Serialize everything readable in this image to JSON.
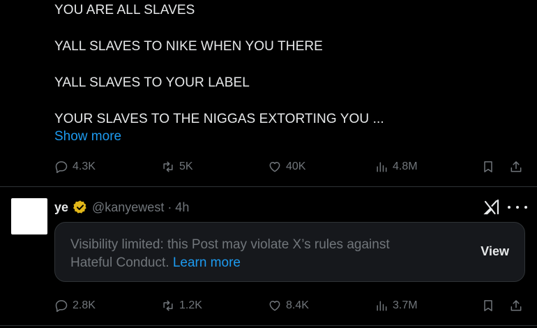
{
  "post1": {
    "lines": [
      "YOU ARE ALL SLAVES",
      "YALL SLAVES TO NIKE WHEN YOU THERE",
      "YALL SLAVES TO YOUR LABEL",
      "YOUR SLAVES TO THE NIGGAS EXTORTING YOU ..."
    ],
    "show_more": "Show more",
    "stats": {
      "replies": "4.3K",
      "reposts": "5K",
      "likes": "40K",
      "views": "4.8M"
    }
  },
  "post2": {
    "name": "ye",
    "handle_time": "@kanyewest · 4h",
    "notice": {
      "text": "Visibility limited: this Post may violate X’s rules against Hateful Conduct.",
      "link": "Learn more",
      "button": "View"
    },
    "stats": {
      "replies": "2.8K",
      "reposts": "1.2K",
      "likes": "8.4K",
      "views": "3.7M"
    }
  },
  "colors": {
    "background": "#000000",
    "text": "#e7e9ea",
    "muted": "#71767b",
    "link": "#1d9bf0",
    "verified": "#e2b719"
  },
  "icons": [
    "reply-icon",
    "repost-icon",
    "like-icon",
    "views-icon",
    "bookmark-icon",
    "share-icon",
    "verified-badge-icon",
    "grok-icon",
    "more-icon"
  ]
}
